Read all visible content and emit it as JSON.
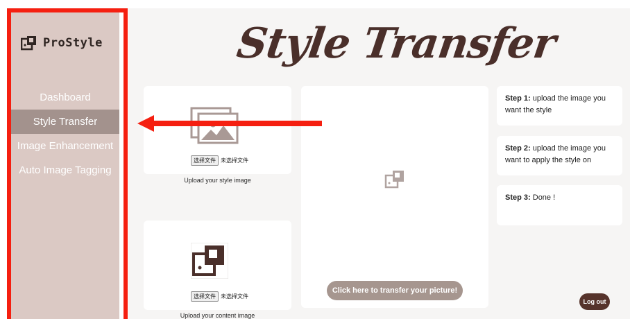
{
  "brand": {
    "name": "ProStyle",
    "icon": "image-frame-icon"
  },
  "sidebar": {
    "items": [
      {
        "label": "Dashboard",
        "active": false
      },
      {
        "label": "Style Transfer",
        "active": true
      },
      {
        "label": "Image Enhancement",
        "active": false
      },
      {
        "label": "Auto Image Tagging",
        "active": false
      }
    ]
  },
  "header": {
    "title": "Style Transfer"
  },
  "style_upload": {
    "icon": "gallery-icon",
    "choose_label": "选择文件",
    "file_status": "未选择文件",
    "caption": "Upload your style image"
  },
  "content_upload": {
    "icon": "image-frame-icon",
    "choose_label": "选择文件",
    "file_status": "未选择文件",
    "caption": "Upload your content image"
  },
  "result": {
    "icon": "image-frame-icon",
    "button_label": "Click here to transfer your picture!"
  },
  "steps": [
    {
      "label": "Step 1:",
      "text": "upload the image you want the style"
    },
    {
      "label": "Step 2:",
      "text": "upload the image you want to apply the style on"
    },
    {
      "label": "Step 3:",
      "text": "Done !"
    }
  ],
  "logout_label": "Log out",
  "colors": {
    "sidebar_bg": "#dbc9c4",
    "sidebar_active": "#a3928d",
    "title": "#4a2f2a",
    "highlight": "#f51f10",
    "logout_bg": "#56332b"
  }
}
